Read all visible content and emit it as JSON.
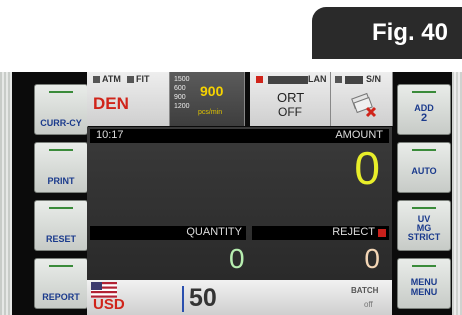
{
  "figure": {
    "label": "Fig. 40"
  },
  "left_keys": [
    {
      "label": "CURR-CY"
    },
    {
      "label": "PRINT"
    },
    {
      "label": "RESET"
    },
    {
      "label": "REPORT"
    }
  ],
  "top": {
    "atm_label": "ATM",
    "fit_label": "FIT",
    "mode": "DEN",
    "speed_options": [
      "1500",
      "600",
      "900",
      "1200"
    ],
    "speed_value": "900",
    "speed_unit": "pcs/min",
    "lan_label": "LAN",
    "ort_label": "ORT",
    "ort_value": "OFF",
    "sn_label": "S/N"
  },
  "display": {
    "time": "10:17",
    "amount_label": "AMOUNT",
    "amount_value": "0",
    "quantity_label": "QUANTITY",
    "quantity_value": "0",
    "reject_label": "REJECT",
    "reject_value": "0"
  },
  "bottom": {
    "currency": "USD",
    "batch_value": "50",
    "batch_label": "BATCH",
    "batch_state": "off"
  },
  "right_keys": [
    {
      "line1": "ADD",
      "line2": "2"
    },
    {
      "line1": "AUTO",
      "line2": ""
    },
    {
      "line1": "UV",
      "line2": "MG",
      "line3": "STRICT"
    },
    {
      "line1": "MENU",
      "line2": "MENU"
    }
  ],
  "colors": {
    "accent_red": "#d0241a",
    "amount_yellow": "#e8ee2a",
    "quantity_green": "#b7eeb0",
    "reject_peach": "#f3d6b6",
    "key_blue": "#1a3a8c"
  }
}
